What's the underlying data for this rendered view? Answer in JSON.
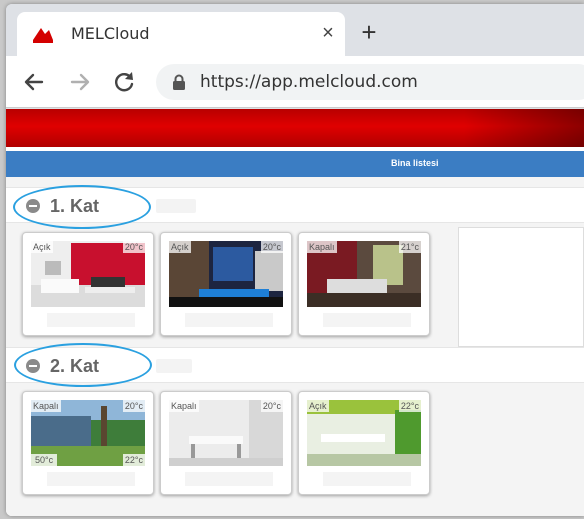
{
  "browser": {
    "tab_title": "MELCloud",
    "close_glyph": "×",
    "new_tab_glyph": "+",
    "url": "https://app.melcloud.com",
    "accent": "#d40000"
  },
  "page": {
    "blue_bar_title": "Bina listesi",
    "brand_red": "#d40000",
    "bar_blue": "#3b7dc3"
  },
  "floors": [
    {
      "title": "1. Kat",
      "units": [
        {
          "status": "Açık",
          "temp": "20°c"
        },
        {
          "status": "Açık",
          "temp": "20°c"
        },
        {
          "status": "Kapalı",
          "temp": "21°c"
        }
      ]
    },
    {
      "title": "2. Kat",
      "units": [
        {
          "status": "Kapalı",
          "temp": "20°c",
          "temp_bottom_left": "50°c",
          "temp_bottom_right": "22°c"
        },
        {
          "status": "Kapalı",
          "temp": "20°c"
        },
        {
          "status": "Açık",
          "temp": "22°c"
        }
      ]
    }
  ]
}
